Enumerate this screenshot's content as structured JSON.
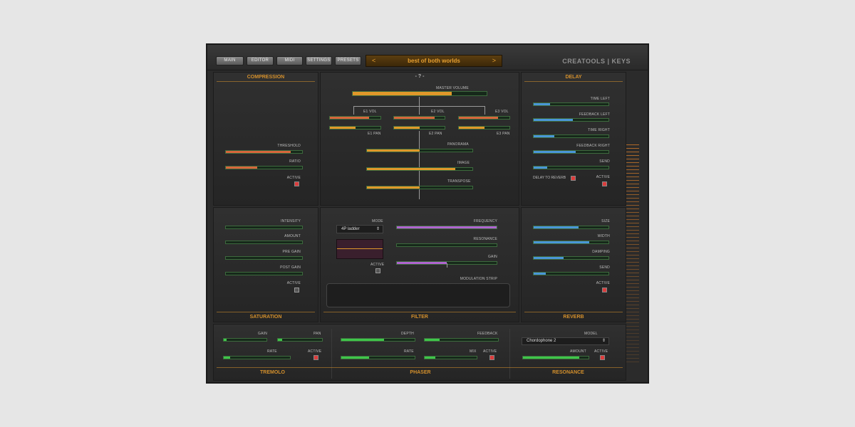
{
  "nav": {
    "main": "MAIN",
    "editor": "EDITOR",
    "midi": "MIDI",
    "settings": "SETTINGS",
    "presets": "PRESETS"
  },
  "preset": {
    "prev": "<",
    "name": "best of both worlds",
    "next": ">"
  },
  "brand": "CREATOOLS | KEYS",
  "compression": {
    "title": "COMPRESSION",
    "threshold": "THRESHOLD",
    "ratio": "RATIO",
    "active": "ACTIVE",
    "threshold_value": 0.85,
    "ratio_value": 0.41,
    "active_on": true
  },
  "center": {
    "help": "- ? -",
    "master_volume": "MASTER VOLUME",
    "master_value": 0.74,
    "e1_vol": "E1 VOL",
    "e2_vol": "E2 VOL",
    "e3_vol": "E3 VOL",
    "e1_pan": "E1 PAN",
    "e2_pan": "E2 PAN",
    "e3_pan": "E3 PAN",
    "e1_vol_value": 0.78,
    "e2_vol_value": 0.8,
    "e3_vol_value": 0.78,
    "e1_pan_value": 0.5,
    "e2_pan_value": 0.5,
    "e3_pan_value": 0.5,
    "panorama": "PANORAMA",
    "image": "IMAGE",
    "transpose": "TRANSPOSE",
    "panorama_value": 0.5,
    "image_value": 0.84,
    "transpose_value": 0.5
  },
  "delay": {
    "title": "DELAY",
    "time_left": "TIME LEFT",
    "feedback_left": "FEEDBACK LEFT",
    "time_right": "TIME RIGHT",
    "feedback_right": "FEEDBACK RIGHT",
    "send": "SEND",
    "delay_to_reverb": "DELAY TO REVERB",
    "active": "ACTIVE",
    "time_left_value": 0.22,
    "feedback_left_value": 0.52,
    "time_right_value": 0.28,
    "feedback_right_value": 0.56,
    "send_value": 0.18
  },
  "saturation": {
    "title": "SATURATION",
    "intensity": "INTENSITY",
    "amount": "AMOUNT",
    "pre_gain": "PRE GAIN",
    "post_gain": "POST GAIN",
    "active": "ACTIVE"
  },
  "filter": {
    "title": "FILTER",
    "mode": "MODE",
    "mode_value": "4P ladder",
    "active": "ACTIVE",
    "frequency": "FREQUENCY",
    "resonance": "RESONANCE",
    "gain": "GAIN",
    "modulation_strip": "MODULATION STRIP",
    "frequency_value": 1.0,
    "resonance_value": 0.0,
    "gain_value": 0.5
  },
  "reverb": {
    "title": "REVERB",
    "size": "SIZE",
    "width": "WIDTH",
    "damping": "DAMPING",
    "send": "SEND",
    "active": "ACTIVE",
    "size_value": 0.6,
    "width_value": 0.74,
    "damping_value": 0.4,
    "send_value": 0.16
  },
  "tremolo": {
    "title": "TREMOLO",
    "gain": "GAIN",
    "pan": "PAN",
    "rate": "RATE",
    "active": "ACTIVE",
    "gain_value": 0.07,
    "pan_value": 0.1,
    "rate_value": 0.1
  },
  "phaser": {
    "title": "PHASER",
    "depth": "DEPTH",
    "feedback": "FEEDBACK",
    "rate": "RATE",
    "mix": "MIX",
    "active": "ACTIVE",
    "depth_value": 0.58,
    "feedback_value": 0.2,
    "rate_value": 0.38,
    "mix_value": 0.2
  },
  "resonance": {
    "title": "RESONANCE",
    "model": "MODEL",
    "model_value": "Chordophone 2",
    "amount": "AMOUNT",
    "active": "ACTIVE",
    "amount_value": 0.86
  },
  "colors": {
    "accent": "#d4902c",
    "orange_fill": "#e0982a",
    "red_fill": "#d7663c",
    "blue_fill": "#4a96d8",
    "purple_fill": "#b064d0",
    "green_fill": "#3fc64a",
    "active_red": "#dc3c3c"
  }
}
